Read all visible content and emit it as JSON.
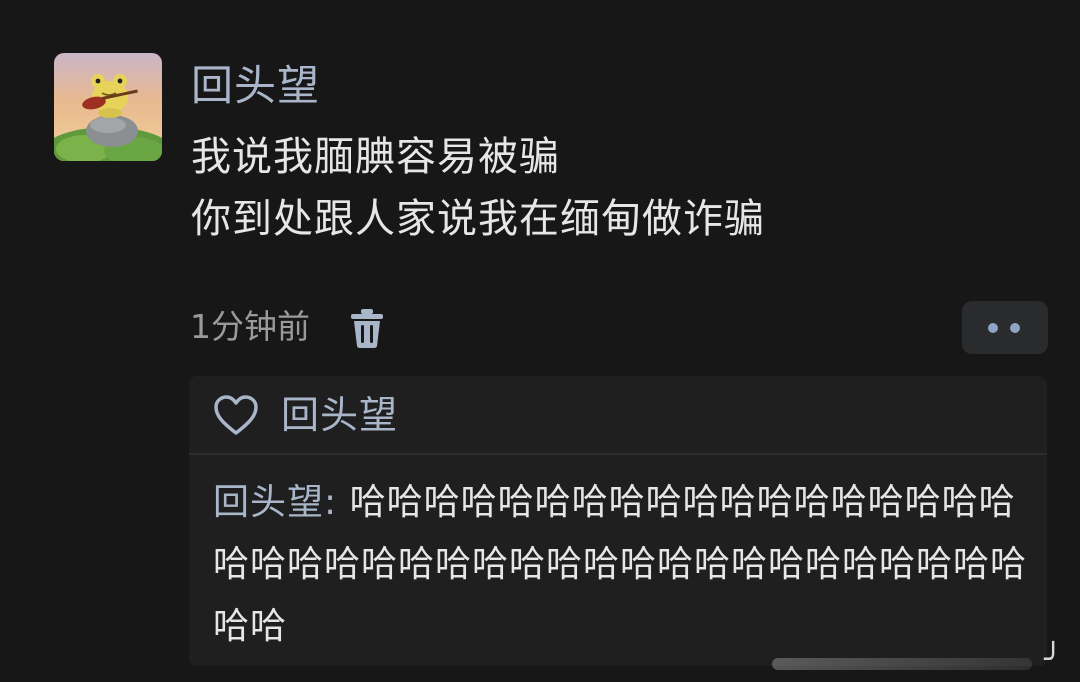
{
  "post": {
    "author": "回头望",
    "content_lines": [
      "我说我腼腆容易被骗",
      "你到处跟人家说我在缅甸做诈骗"
    ],
    "time": "1分钟前"
  },
  "likes": {
    "names": "回头望"
  },
  "reply": {
    "author": "回头望",
    "separator": ": ",
    "text": "哈哈哈哈哈哈哈哈哈哈哈哈哈哈哈哈哈哈哈哈哈哈哈哈哈哈哈哈哈哈哈哈哈哈哈哈哈哈哈哈哈哈"
  },
  "icons": {
    "avatar": "frog-with-ukulele-avatar",
    "delete": "trash-icon",
    "more": "more-dots-icon",
    "like": "heart-icon"
  },
  "colors": {
    "background": "#171717",
    "name_accent": "#a9b5c9",
    "text": "#e6e6e6",
    "muted": "#9a9a9a",
    "panel": "#1f1f1f"
  }
}
